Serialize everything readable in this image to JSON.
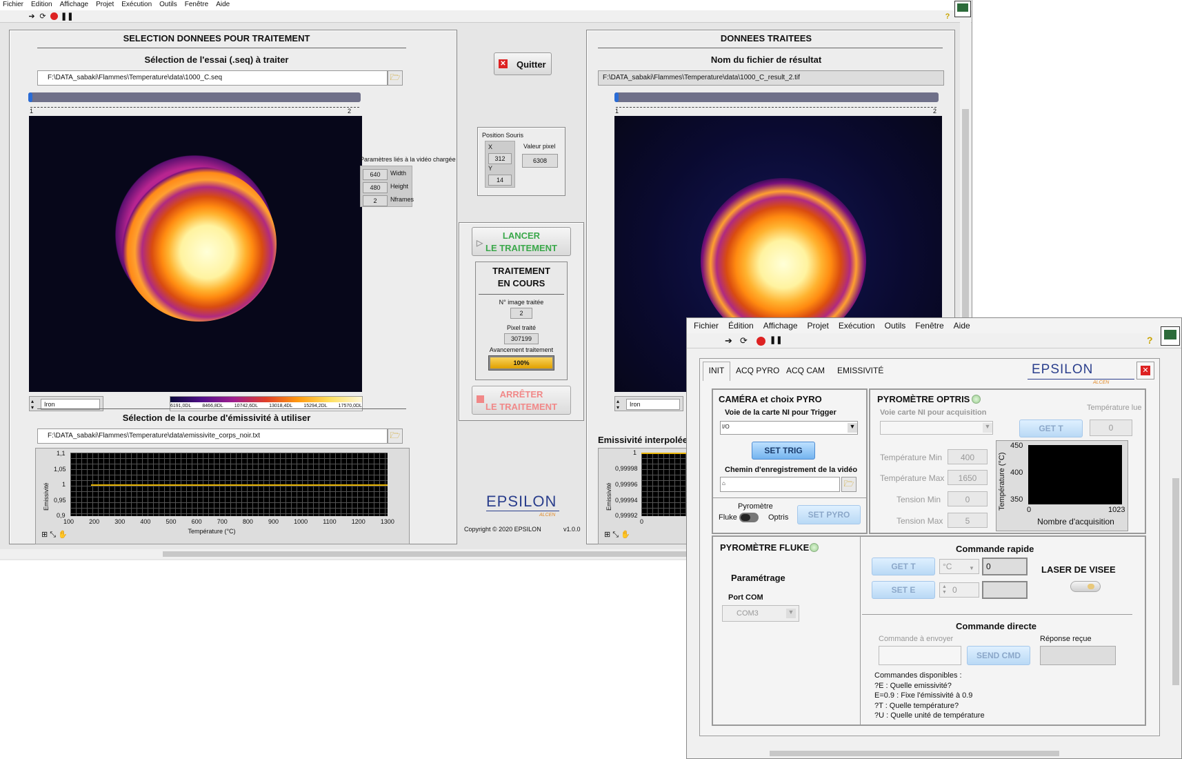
{
  "main_window": {
    "menu": [
      "Fichier",
      "Edition",
      "Affichage",
      "Projet",
      "Exécution",
      "Outils",
      "Fenêtre",
      "Aide"
    ],
    "left_panel": {
      "title": "SELECTION DONNEES POUR TRAITEMENT",
      "essai_label": "Sélection de l'essai (.seq) à traiter",
      "essai_path": "F:\\DATA_sabaki\\Flammes\\Temperature\\data\\1000_C.seq",
      "slider_min": "1",
      "slider_max": "2",
      "colormap": "Iron",
      "colorbar_ticks": [
        "6191,0DL",
        "8466,8DL",
        "10742,6DL",
        "13018,4DL",
        "15294,2DL",
        "17570,0DL"
      ],
      "params_title": "Paramètres liés à la vidéo chargée",
      "params": [
        {
          "value": "640",
          "label": "Width"
        },
        {
          "value": "480",
          "label": "Height"
        },
        {
          "value": "2",
          "label": "Nframes"
        }
      ],
      "emiss_label": "Sélection de la courbe d'émissivité à utiliser",
      "emiss_path": "F:\\DATA_sabaki\\Flammes\\Temperature\\data\\emissivite_corps_noir.txt",
      "emiss_chart": {
        "ylabel": "Emissivité",
        "xlabel": "Température (°C)",
        "yticks": [
          "1,1",
          "1,05",
          "1",
          "0,95",
          "0,9"
        ],
        "xticks": [
          "100",
          "200",
          "300",
          "400",
          "500",
          "600",
          "700",
          "800",
          "900",
          "1000",
          "1100",
          "1200",
          "1300"
        ]
      }
    },
    "middle": {
      "quit_label": "Quitter",
      "mouse_title": "Position Souris",
      "x_label": "X",
      "x_value": "312",
      "y_label": "Y",
      "y_value": "14",
      "pixel_label": "Valeur pixel",
      "pixel_value": "6308",
      "launch_line1": "LANCER",
      "launch_line2": "LE TRAITEMENT",
      "status_line1": "TRAITEMENT",
      "status_line2": "EN COURS",
      "image_label": "N° image traitée",
      "image_value": "2",
      "pixel_treated_label": "Pixel traité",
      "pixel_treated_value": "307199",
      "progress_label": "Avancement traitement",
      "progress_value": "100%",
      "stop_line1": "ARRÊTER",
      "stop_line2": "LE TRAITEMENT",
      "logo": "EPSILON",
      "logo_sub": "ALCEN",
      "copyright": "Copyright © 2020 EPSILON",
      "version": "v1.0.0"
    },
    "right_panel": {
      "title": "DONNEES TRAITEES",
      "result_label": "Nom du fichier de résultat",
      "result_path": "F:\\DATA_sabaki\\Flammes\\Temperature\\data\\1000_C_result_2.tif",
      "slider_min": "1",
      "slider_max": "2",
      "colormap": "Iron",
      "emiss_interp_label": "Emissivité interpolée",
      "yticks": [
        "1",
        "0,99998",
        "0,99996",
        "0,99994",
        "0,99992"
      ],
      "ylabel": "Emissivité",
      "xtick": "0"
    }
  },
  "second_window": {
    "menu": [
      "Fichier",
      "Édition",
      "Affichage",
      "Projet",
      "Exécution",
      "Outils",
      "Fenêtre",
      "Aide"
    ],
    "tabs": [
      "INIT",
      "ACQ PYRO",
      "ACQ CAM",
      "EMISSIVITÉ"
    ],
    "logo": "EPSILON",
    "logo_sub": "ALCEN",
    "camera": {
      "title": "CAMÉRA et choix PYRO",
      "trigger_label": "Voie de la carte NI pour Trigger",
      "set_trig": "SET TRIG",
      "video_path_label": "Chemin d'enregistrement de la vidéo",
      "pyro_label": "Pyromètre",
      "fluke": "Fluke",
      "optris": "Optris",
      "set_pyro": "SET PYRO"
    },
    "optris": {
      "title": "PYROMÈTRE OPTRIS",
      "acq_label": "Voie carte NI pour acquisition",
      "get_t": "GET T",
      "temp_lue_label": "Température lue",
      "temp_lue": "0",
      "fields": [
        {
          "label": "Température Min",
          "value": "400"
        },
        {
          "label": "Température Max",
          "value": "1650"
        },
        {
          "label": "Tension Min",
          "value": "0"
        },
        {
          "label": "Tension Max",
          "value": "5"
        }
      ],
      "chart_ylabel": "Température (°C)",
      "chart_xlabel": "Nombre d'acquisition",
      "chart_yticks": [
        "450",
        "400",
        "350"
      ],
      "chart_xticks": [
        "0",
        "1023"
      ]
    },
    "fluke": {
      "title": "PYROMÈTRE FLUKE",
      "param": "Paramétrage",
      "port_label": "Port COM",
      "port_value": "COM3",
      "cmd_rapide": "Commande rapide",
      "get_t": "GET T",
      "unit": "°C",
      "get_t_value": "0",
      "set_e": "SET E",
      "set_e_value": "0",
      "laser": "LASER DE VISEE",
      "cmd_directe": "Commande directe",
      "cmd_envoyer": "Commande à envoyer",
      "send": "SEND CMD",
      "reponse": "Réponse reçue",
      "dispo_title": "Commandes disponibles :",
      "dispo": [
        "?E : Quelle emissivité?",
        "E=0.9 : Fixe l'émissivité à 0.9",
        "?T : Quelle température?",
        "?U : Quelle unité de température"
      ]
    }
  }
}
